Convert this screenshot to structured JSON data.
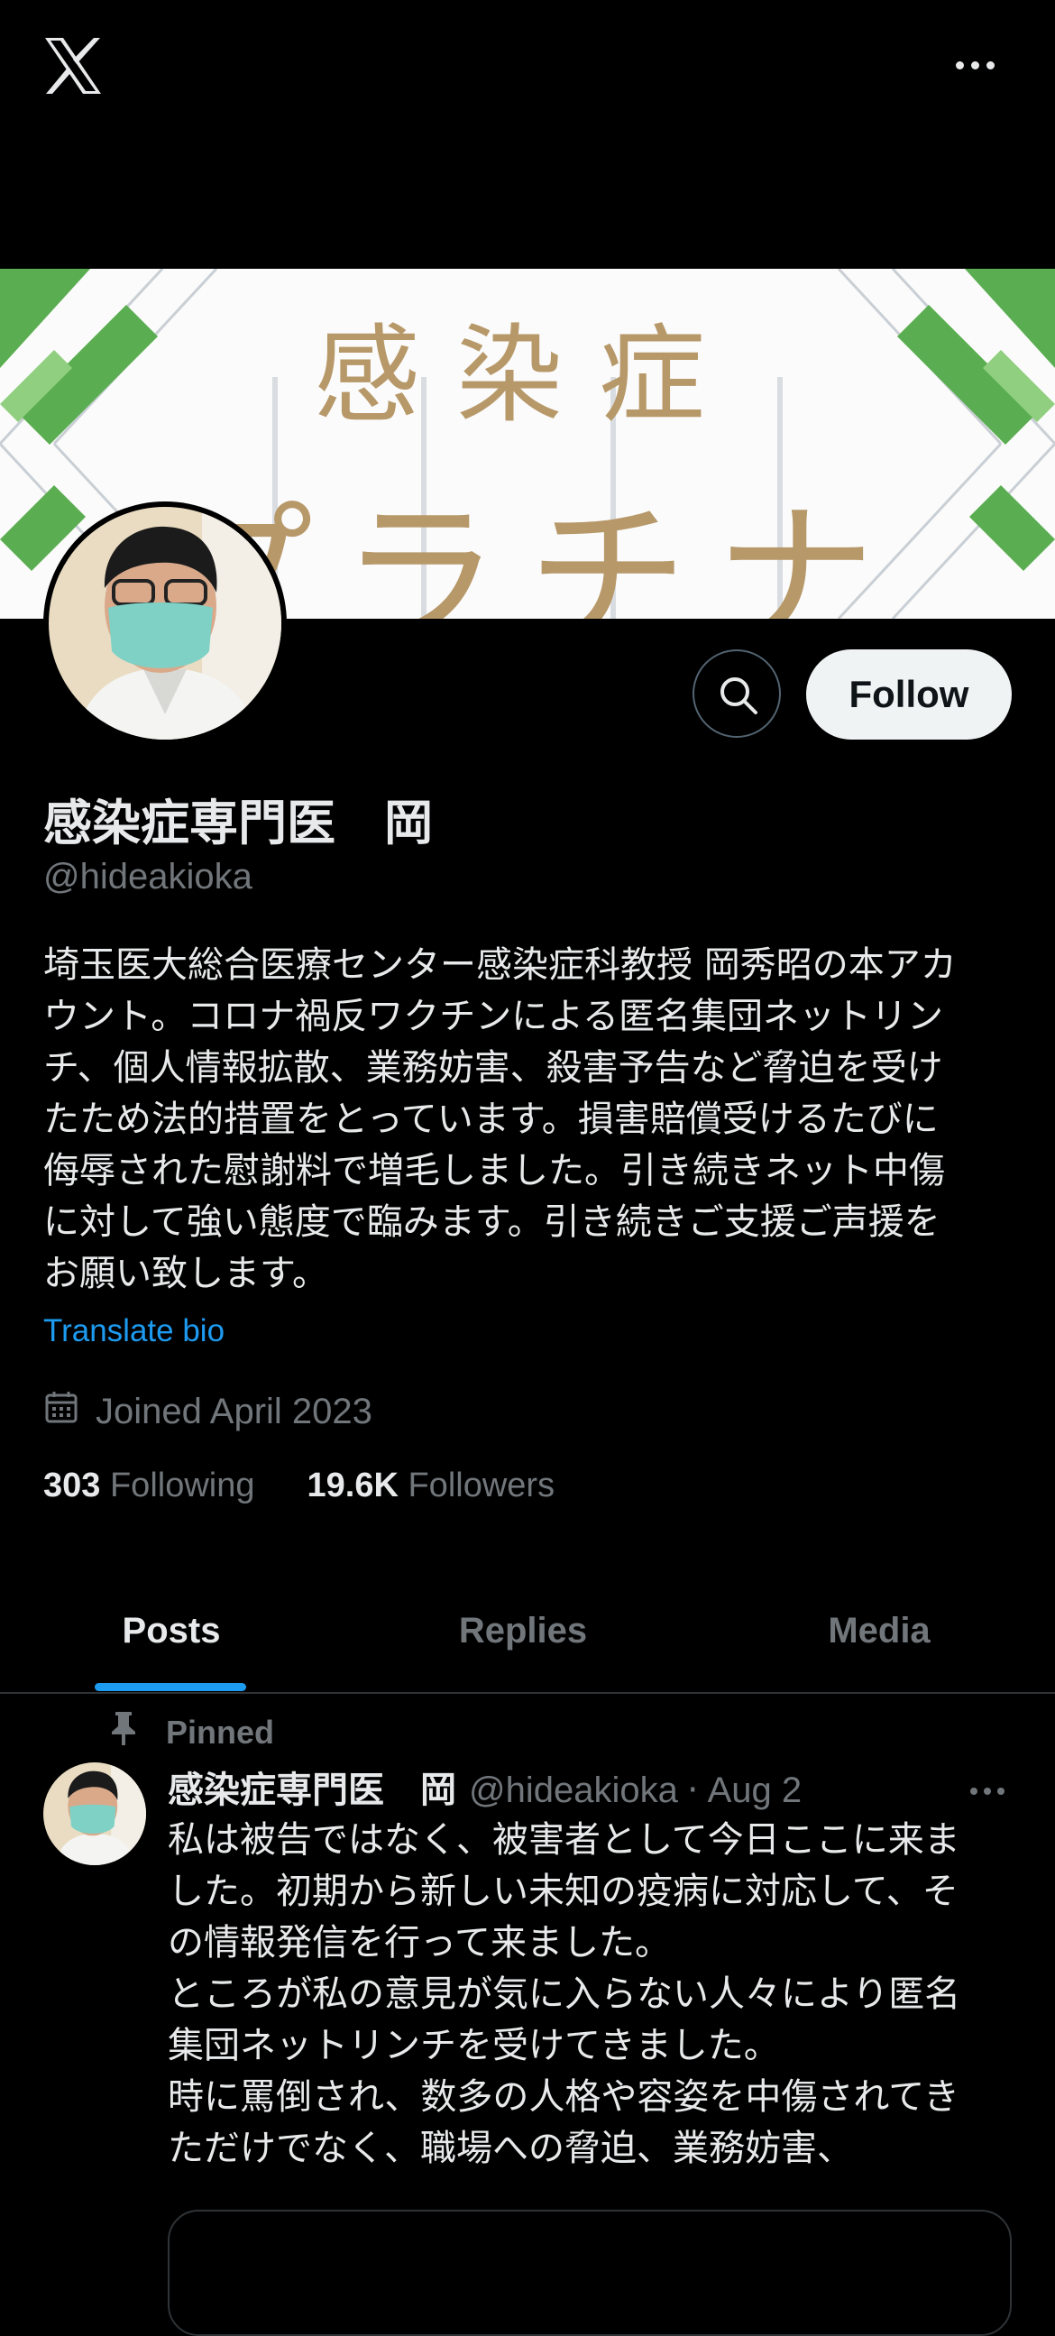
{
  "topbar": {
    "logo_icon": "x-logo-icon",
    "more_icon": "more-horizontal-icon"
  },
  "banner": {
    "line1": "感染症",
    "line2": "プラチナ",
    "accent_color": "#b79869"
  },
  "profile": {
    "display_name": "感染症専門医　岡",
    "handle": "@hideakioka",
    "bio": "埼玉医大総合医療センター感染症科教授 岡秀昭の本アカ\nウント。コロナ禍反ワクチンによる匿名集団ネットリン\nチ、個人情報拡散、業務妨害、殺害予告など脅迫を受け\nたため法的措置をとっています。損害賠償受けるたびに\n侮辱された慰謝料で増毛しました。引き続きネット中傷\nに対して強い態度で臨みます。引き続きご支援ご声援を\nお願い致します。",
    "translate_label": "Translate bio",
    "joined": "Joined April 2023",
    "following_count": "303",
    "following_label": "Following",
    "followers_count": "19.6K",
    "followers_label": "Followers"
  },
  "actions": {
    "follow_label": "Follow",
    "search_icon": "search-icon"
  },
  "tabs": [
    {
      "label": "Posts",
      "active": true
    },
    {
      "label": "Replies",
      "active": false
    },
    {
      "label": "Media",
      "active": false
    }
  ],
  "pinned_post": {
    "pinned_label": "Pinned",
    "author_name": "感染症専門医　岡",
    "author_handle": "@hideakioka",
    "separator": "·",
    "date": "Aug 2",
    "text": "私は被告ではなく、被害者として今日ここに来ま\nした。初期から新しい未知の疫病に対応して、そ\nの情報発信を行って来ました。\nところが私の意見が気に入らない人々により匿名\n集団ネットリンチを受けてきました。\n時に罵倒され、数多の人格や容姿を中傷されてき\nただけでなく、職場への脅迫、業務妨害、"
  },
  "colors": {
    "background": "#000000",
    "text": "#e7e9ea",
    "muted": "#71767b",
    "link": "#1d9bf0",
    "border": "#2f3336"
  }
}
